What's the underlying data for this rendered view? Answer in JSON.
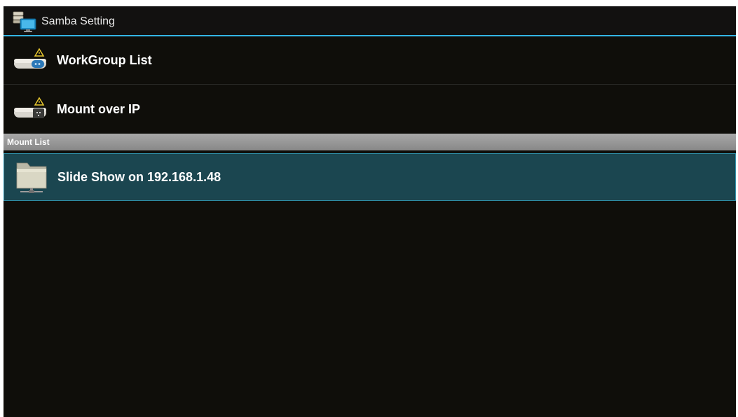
{
  "header": {
    "title": "Samba Setting",
    "icon": "samba-network-icon"
  },
  "menu": {
    "items": [
      {
        "label": "WorkGroup List",
        "icon": "workgroup-drive-icon"
      },
      {
        "label": "Mount over IP",
        "icon": "mount-drive-icon"
      }
    ]
  },
  "mount_list": {
    "header": "Mount List",
    "items": [
      {
        "label": "Slide Show on 192.168.1.48",
        "icon": "network-folder-icon",
        "selected": true
      }
    ]
  },
  "colors": {
    "background": "#0f0e0a",
    "accent": "#33b5e5",
    "selected_bg": "#1b4650",
    "section_header": "#999999"
  }
}
